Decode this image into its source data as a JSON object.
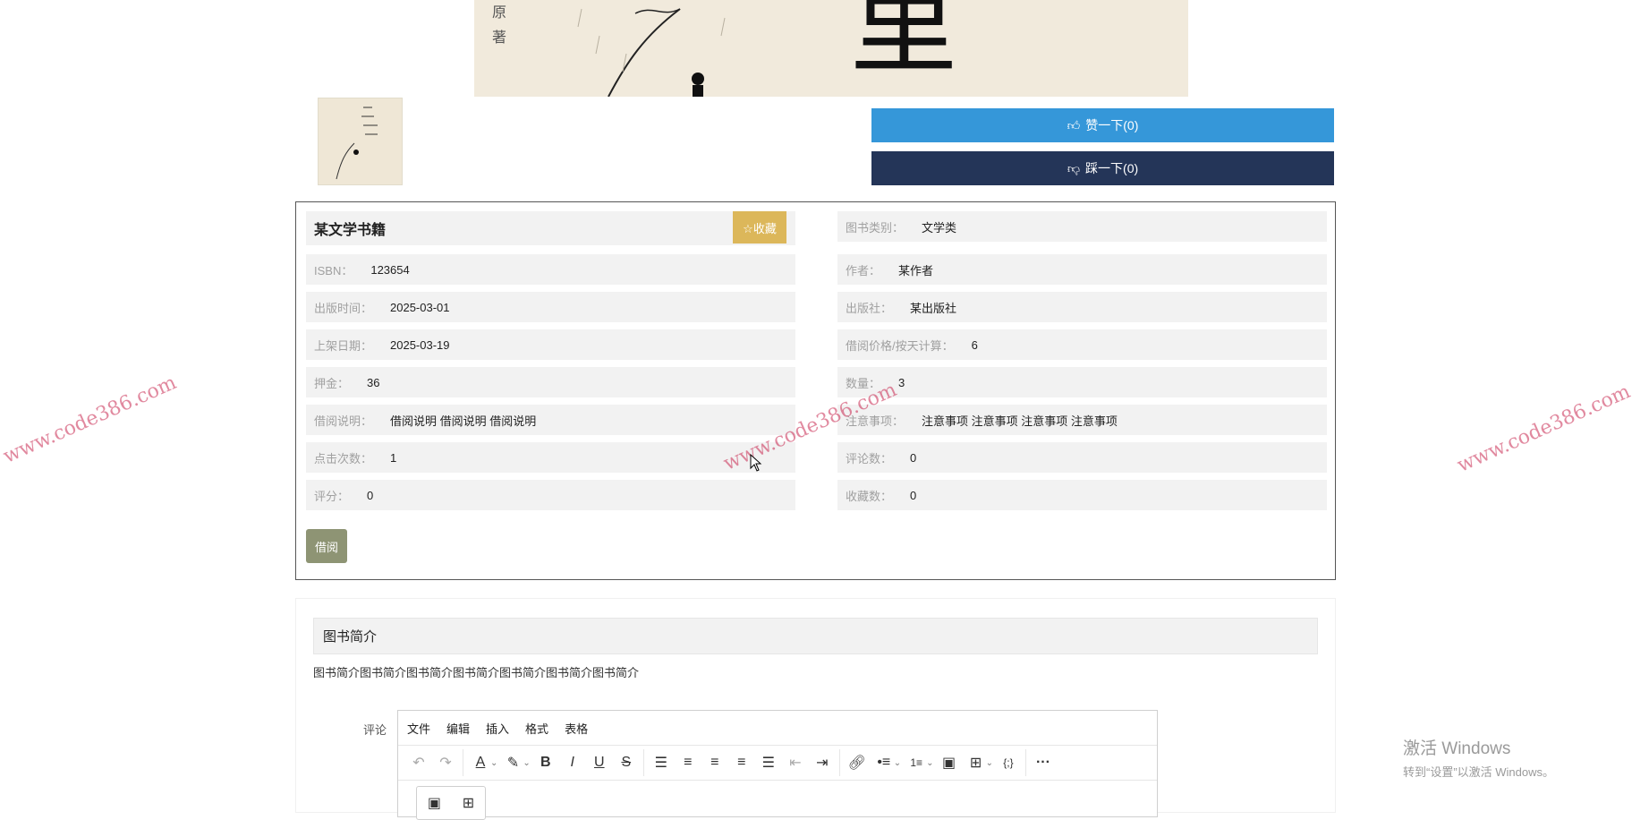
{
  "cover": {
    "spine_char1": "原",
    "spine_char2": "著",
    "big_char": "里"
  },
  "actions": {
    "like_label": "赞一下(0)",
    "dislike_label": "踩一下(0)"
  },
  "book": {
    "title": "某文学书籍",
    "favorite_label": "☆收藏",
    "fields_left": [
      {
        "label": "ISBN：",
        "value": "123654"
      },
      {
        "label": "出版时间：",
        "value": "2025-03-01"
      },
      {
        "label": "上架日期：",
        "value": "2025-03-19"
      },
      {
        "label": "押金：",
        "value": "36"
      },
      {
        "label": "借阅说明：",
        "value": "借阅说明 借阅说明 借阅说明"
      },
      {
        "label": "点击次数：",
        "value": "1"
      },
      {
        "label": "评分：",
        "value": "0"
      }
    ],
    "fields_right": [
      {
        "label": "图书类别：",
        "value": "文学类"
      },
      {
        "label": "作者：",
        "value": "某作者"
      },
      {
        "label": "出版社：",
        "value": "某出版社"
      },
      {
        "label": "借阅价格/按天计算：",
        "value": "6"
      },
      {
        "label": "数量：",
        "value": "3"
      },
      {
        "label": "注意事项：",
        "value": "注意事项 注意事项 注意事项 注意事项"
      },
      {
        "label": "评论数：",
        "value": "0"
      },
      {
        "label": "收藏数：",
        "value": "0"
      }
    ],
    "borrow_label": "借阅"
  },
  "intro": {
    "heading": "图书简介",
    "text": "图书简介图书简介图书简介图书简介图书简介图书简介图书简介"
  },
  "comment": {
    "label": "评论",
    "menu": [
      "文件",
      "编辑",
      "插入",
      "格式",
      "表格"
    ]
  },
  "watermark": "www.code386.com",
  "activation": {
    "line1": "激活 Windows",
    "line2": "转到“设置”以激活 Windows。"
  }
}
